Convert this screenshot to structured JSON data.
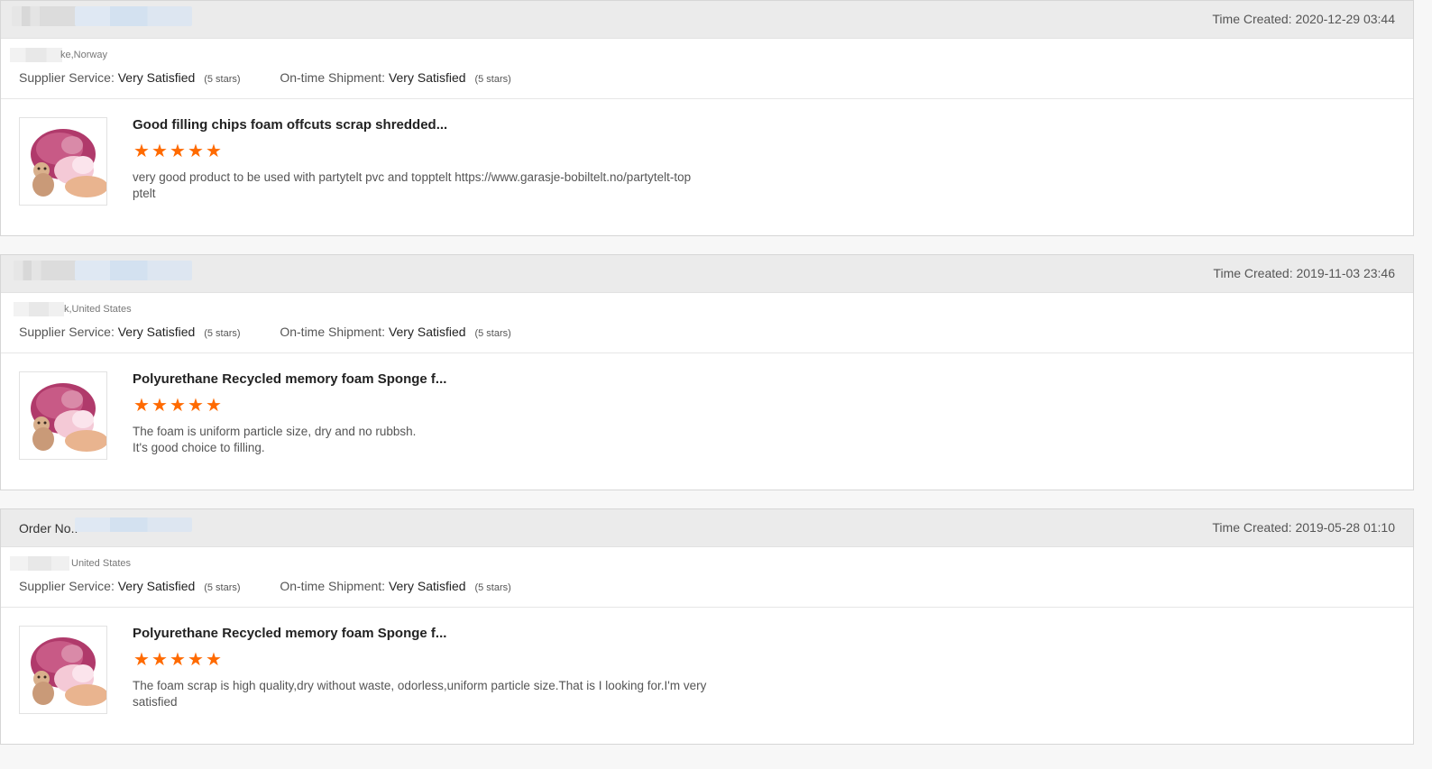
{
  "reviews": [
    {
      "order_label": "",
      "time_created": "Time Created: 2020-12-29 03:44",
      "location": "ke,Norway",
      "supplier_service": {
        "label": "Supplier Service:",
        "value": "Very Satisfied",
        "stars_text": "(5 stars)"
      },
      "ontime_shipment": {
        "label": "On-time Shipment:",
        "value": "Very Satisfied",
        "stars_text": "(5 stars)"
      },
      "product_title": "Good filling chips foam offcuts scrap shredded...",
      "rating": 5,
      "review_text": "very good product to be used with partytelt pvc and topptelt  https://www.garasje-bobiltelt.no/partytelt-top\nptelt"
    },
    {
      "order_label": "",
      "time_created": "Time Created: 2019-11-03 23:46",
      "location": "k,United States",
      "supplier_service": {
        "label": "Supplier Service:",
        "value": "Very Satisfied",
        "stars_text": "(5 stars)"
      },
      "ontime_shipment": {
        "label": "On-time Shipment:",
        "value": "Very Satisfied",
        "stars_text": "(5 stars)"
      },
      "product_title": "Polyurethane Recycled memory foam Sponge f...",
      "rating": 5,
      "review_text": "The foam is uniform particle size, dry and no rubbsh.\nIt's good choice to filling."
    },
    {
      "order_label": "Order No.:",
      "time_created": "Time Created: 2019-05-28 01:10",
      "location": "United States",
      "supplier_service": {
        "label": "Supplier Service:",
        "value": "Very Satisfied",
        "stars_text": "(5 stars)"
      },
      "ontime_shipment": {
        "label": "On-time Shipment:",
        "value": "Very Satisfied",
        "stars_text": "(5 stars)"
      },
      "product_title": "Polyurethane Recycled memory foam Sponge f...",
      "rating": 5,
      "review_text": "The foam scrap is high quality,dry without waste, odorless,uniform particle size.That is I looking for.I'm very\nsatisfied"
    }
  ],
  "colors": {
    "star": "#ff6a00",
    "header_bg": "#ebebeb",
    "card_border": "#d6d6d6"
  },
  "icons": {
    "star": "star-icon",
    "thumbnail": "product-thumbnail-image"
  }
}
